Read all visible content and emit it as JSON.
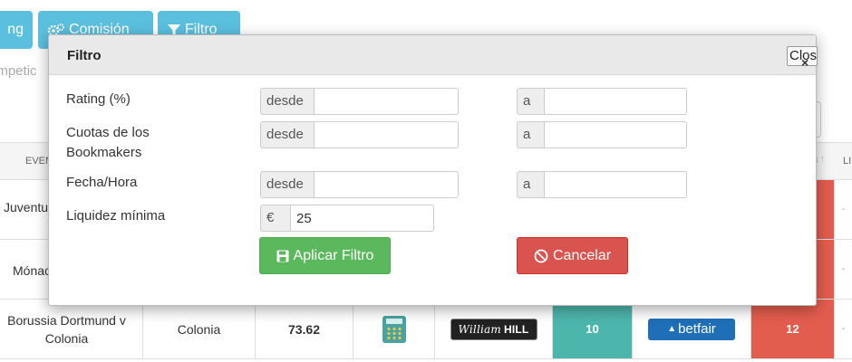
{
  "background": {
    "toolbar": {
      "rating_label": "ng",
      "comision_label": "Comisión",
      "filtro_label": "Filtro"
    },
    "search_placeholder": "ompetic",
    "table": {
      "header_event": "EVEN",
      "header_sort": "↓↑",
      "header_last": "LI",
      "rows": [
        {
          "event": "Juventu",
          "dash": "-"
        },
        {
          "event": "Mónac",
          "dash": "-"
        },
        {
          "event": "Borussia Dortmund v Colonia",
          "team": "Colonia",
          "rating": "73.62",
          "bookmaker": "William HILL",
          "back_odds": "10",
          "exchange": "betfair",
          "lay_odds": "12",
          "dash": "-"
        }
      ]
    },
    "colors": {
      "teal": "#4db6ac",
      "red": "#e35d4e",
      "info": "#5bc0de"
    }
  },
  "modal": {
    "title": "Filtro",
    "close_label": "Close",
    "close_icon": "×",
    "rows": [
      {
        "label": "Rating (%)",
        "from_addon": "desde",
        "from_value": "",
        "to_addon": "a",
        "to_value": ""
      },
      {
        "label": "Cuotas de los Bookmakers",
        "from_addon": "desde",
        "from_value": "",
        "to_addon": "a",
        "to_value": ""
      },
      {
        "label": "Fecha/Hora",
        "from_addon": "desde",
        "from_value": "",
        "to_addon": "a",
        "to_value": ""
      }
    ],
    "liquidity": {
      "label": "Liquidez mínima",
      "addon": "€",
      "value": "25"
    },
    "apply_label": "Aplicar Filtro",
    "cancel_label": "Cancelar",
    "colors": {
      "apply": "#5cb85c",
      "cancel": "#d9534f"
    }
  }
}
